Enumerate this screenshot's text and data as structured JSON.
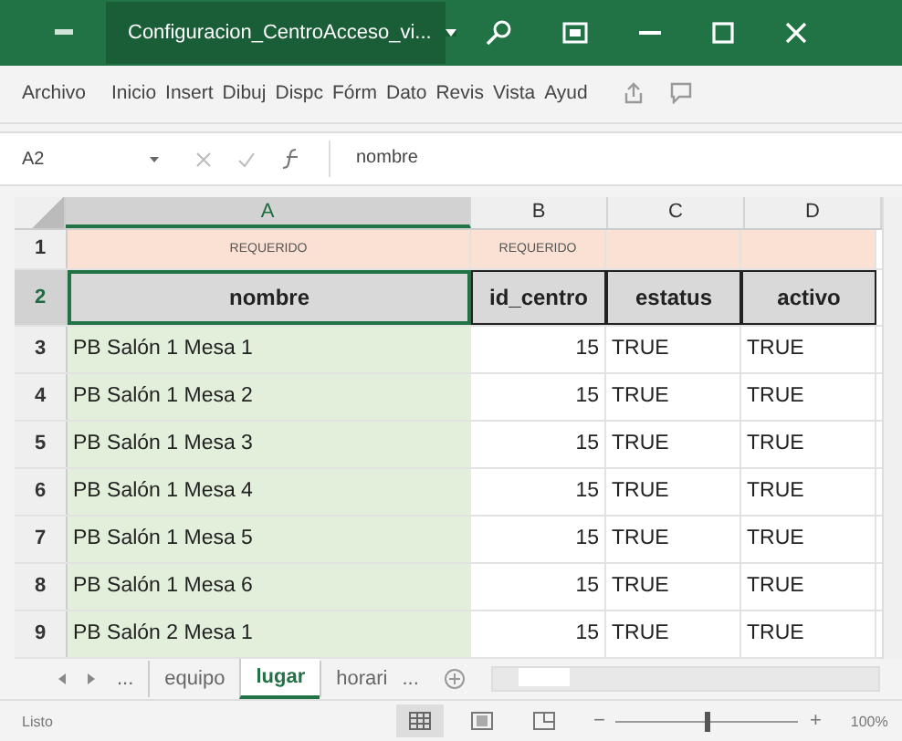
{
  "window": {
    "title": "Configuracion_CentroAcceso_vi..."
  },
  "ribbon_tabs": [
    "Archivo",
    "Inicio",
    "Insert",
    "Dibuj",
    "Dispc",
    "Fórm",
    "Dato",
    "Revis",
    "Vista",
    "Ayud"
  ],
  "formula_bar": {
    "name_box": "A2",
    "formula": "nombre"
  },
  "sheet": {
    "columns": [
      {
        "label": "A",
        "selected": true
      },
      {
        "label": "B",
        "selected": false
      },
      {
        "label": "C",
        "selected": false
      },
      {
        "label": "D",
        "selected": false
      }
    ],
    "rows": [
      {
        "number": "1",
        "kind": "required",
        "selected": false,
        "cells": [
          "REQUERIDO",
          "REQUERIDO"
        ]
      },
      {
        "number": "2",
        "kind": "header",
        "selected": true,
        "cells": [
          "nombre",
          "id_centro",
          "estatus",
          "activo"
        ]
      },
      {
        "number": "3",
        "kind": "data",
        "selected": false,
        "cells": [
          "PB Salón 1 Mesa 1",
          "15",
          "TRUE",
          "TRUE"
        ]
      },
      {
        "number": "4",
        "kind": "data",
        "selected": false,
        "cells": [
          "PB Salón 1 Mesa 2",
          "15",
          "TRUE",
          "TRUE"
        ]
      },
      {
        "number": "5",
        "kind": "data",
        "selected": false,
        "cells": [
          "PB Salón 1 Mesa 3",
          "15",
          "TRUE",
          "TRUE"
        ]
      },
      {
        "number": "6",
        "kind": "data",
        "selected": false,
        "cells": [
          "PB Salón 1 Mesa 4",
          "15",
          "TRUE",
          "TRUE"
        ]
      },
      {
        "number": "7",
        "kind": "data",
        "selected": false,
        "cells": [
          "PB Salón 1 Mesa 5",
          "15",
          "TRUE",
          "TRUE"
        ]
      },
      {
        "number": "8",
        "kind": "data",
        "selected": false,
        "cells": [
          "PB Salón 1 Mesa 6",
          "15",
          "TRUE",
          "TRUE"
        ]
      },
      {
        "number": "9",
        "kind": "data",
        "selected": false,
        "cells": [
          "PB Salón 2 Mesa 1",
          "15",
          "TRUE",
          "TRUE"
        ]
      }
    ]
  },
  "sheet_tabs": {
    "more_left": "...",
    "tabs": [
      {
        "label": "equipo",
        "selected": false
      },
      {
        "label": "lugar",
        "selected": true
      },
      {
        "label": "horari",
        "selected": false
      }
    ],
    "more_right": "..."
  },
  "status_bar": {
    "text": "Listo",
    "zoom_out": "−",
    "zoom_in": "+",
    "zoom": "100%",
    "zoom_level": {
      "level": 0.5
    }
  }
}
